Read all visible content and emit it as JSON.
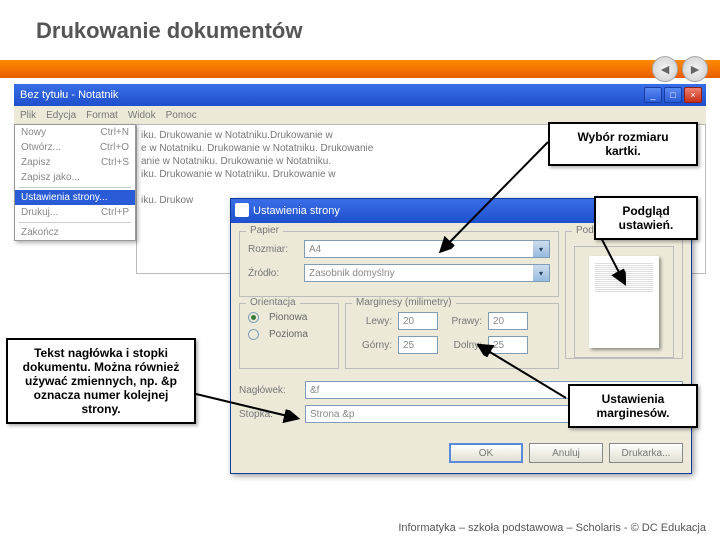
{
  "slide": {
    "title": "Drukowanie dokumentów"
  },
  "footer": "Informatyka – szkoła podstawowa – Scholaris - © DC Edukacja",
  "notepad": {
    "title": "Bez tytułu - Notatnik",
    "menus": [
      "Plik",
      "Edycja",
      "Format",
      "Widok",
      "Pomoc"
    ],
    "filemenu": {
      "items": [
        {
          "label": "Nowy",
          "accel": "Ctrl+N"
        },
        {
          "label": "Otwórz...",
          "accel": "Ctrl+O"
        },
        {
          "label": "Zapisz",
          "accel": "Ctrl+S"
        },
        {
          "label": "Zapisz jako...",
          "accel": ""
        }
      ],
      "highlighted": {
        "label": "Ustawienia strony...",
        "accel": ""
      },
      "items2": [
        {
          "label": "Drukuj...",
          "accel": "Ctrl+P"
        }
      ],
      "items3": [
        {
          "label": "Zakończ",
          "accel": ""
        }
      ]
    },
    "body": "iku. Drukowanie w Notatniku.Drukowanie w\ne w Notatniku. Drukowanie w Notatniku. Drukowanie\nanie w Notatniku. Drukowanie w Notatniku.\niku. Drukowanie w Notatniku. Drukowanie w\n\niku. Drukow"
  },
  "dialog": {
    "title": "Ustawienia strony",
    "groups": {
      "paper": "Papier",
      "size_label": "Rozmiar:",
      "size_value": "A4",
      "source_label": "Źródło:",
      "source_value": "Zasobnik domyślny",
      "orientation": "Orientacja",
      "portrait": "Pionowa",
      "landscape": "Pozioma",
      "margins": "Marginesy (milimetry)",
      "left": "Lewy:",
      "right": "Prawy:",
      "top": "Górny:",
      "bottom": "Dolny:",
      "left_v": "20",
      "right_v": "20",
      "top_v": "25",
      "bottom_v": "25",
      "preview": "Podgląd",
      "header_lbl": "Nagłówek:",
      "header_v": "&f",
      "footer_lbl": "Stopka:",
      "footer_v": "Strona &p"
    },
    "buttons": {
      "ok": "OK",
      "cancel": "Anuluj",
      "printer": "Drukarka..."
    }
  },
  "callouts": {
    "c1": "Wybór rozmiaru kartki.",
    "c2": "Podgląd ustawień.",
    "c3": "Tekst nagłówka i stopki dokumentu. Można również używać zmiennych, np. &p oznacza numer kolejnej strony.",
    "c4": "Ustawienia marginesów."
  }
}
